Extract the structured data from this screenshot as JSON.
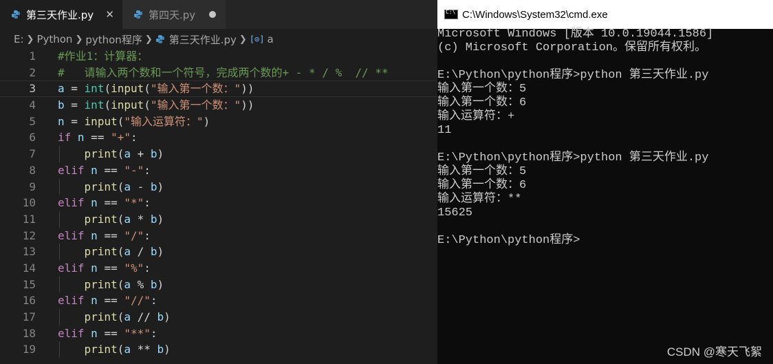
{
  "editor": {
    "tabs": [
      {
        "label": "第三天作业.py",
        "active": true,
        "close_glyph": "✕"
      },
      {
        "label": "第四天.py",
        "active": false
      }
    ],
    "breadcrumb": [
      "E:",
      "Python",
      "python程序",
      "第三天作业.py",
      "a"
    ],
    "current_line": 3,
    "lines": [
      {
        "n": "1",
        "tokens": [
          [
            "cmt",
            "#作业1：计算器："
          ]
        ]
      },
      {
        "n": "2",
        "tokens": [
          [
            "cmt",
            "#   请输入两个数和一个符号，完成两个数的+ - * / %  // **"
          ]
        ]
      },
      {
        "n": "3",
        "tokens": [
          [
            "var",
            "a"
          ],
          [
            "op",
            " = "
          ],
          [
            "bi",
            "int"
          ],
          [
            "op",
            "("
          ],
          [
            "fn",
            "input"
          ],
          [
            "op",
            "("
          ],
          [
            "str",
            "\"输入第一个数：\""
          ],
          [
            "op",
            "))"
          ]
        ]
      },
      {
        "n": "4",
        "tokens": [
          [
            "var",
            "b"
          ],
          [
            "op",
            " = "
          ],
          [
            "bi",
            "int"
          ],
          [
            "op",
            "("
          ],
          [
            "fn",
            "input"
          ],
          [
            "op",
            "("
          ],
          [
            "str",
            "\"输入第一个数：\""
          ],
          [
            "op",
            "))"
          ]
        ]
      },
      {
        "n": "5",
        "tokens": [
          [
            "var",
            "n"
          ],
          [
            "op",
            " = "
          ],
          [
            "fn",
            "input"
          ],
          [
            "op",
            "("
          ],
          [
            "str",
            "\"输入运算符：\""
          ],
          [
            "op",
            ")"
          ]
        ]
      },
      {
        "n": "6",
        "tokens": [
          [
            "kw",
            "if"
          ],
          [
            "op",
            " "
          ],
          [
            "var",
            "n"
          ],
          [
            "op",
            " == "
          ],
          [
            "str",
            "\"+\""
          ],
          [
            "op",
            ":"
          ]
        ]
      },
      {
        "n": "7",
        "indent": true,
        "tokens": [
          [
            "op",
            "    "
          ],
          [
            "fn",
            "print"
          ],
          [
            "op",
            "("
          ],
          [
            "var",
            "a"
          ],
          [
            "op",
            " + "
          ],
          [
            "var",
            "b"
          ],
          [
            "op",
            ")"
          ]
        ]
      },
      {
        "n": "8",
        "tokens": [
          [
            "kw",
            "elif"
          ],
          [
            "op",
            " "
          ],
          [
            "var",
            "n"
          ],
          [
            "op",
            " == "
          ],
          [
            "str",
            "\"-\""
          ],
          [
            "op",
            ":"
          ]
        ]
      },
      {
        "n": "9",
        "indent": true,
        "tokens": [
          [
            "op",
            "    "
          ],
          [
            "fn",
            "print"
          ],
          [
            "op",
            "("
          ],
          [
            "var",
            "a"
          ],
          [
            "op",
            " - "
          ],
          [
            "var",
            "b"
          ],
          [
            "op",
            ")"
          ]
        ]
      },
      {
        "n": "10",
        "tokens": [
          [
            "kw",
            "elif"
          ],
          [
            "op",
            " "
          ],
          [
            "var",
            "n"
          ],
          [
            "op",
            " == "
          ],
          [
            "str",
            "\"*\""
          ],
          [
            "op",
            ":"
          ]
        ]
      },
      {
        "n": "11",
        "indent": true,
        "tokens": [
          [
            "op",
            "    "
          ],
          [
            "fn",
            "print"
          ],
          [
            "op",
            "("
          ],
          [
            "var",
            "a"
          ],
          [
            "op",
            " * "
          ],
          [
            "var",
            "b"
          ],
          [
            "op",
            ")"
          ]
        ]
      },
      {
        "n": "12",
        "tokens": [
          [
            "kw",
            "elif"
          ],
          [
            "op",
            " "
          ],
          [
            "var",
            "n"
          ],
          [
            "op",
            " == "
          ],
          [
            "str",
            "\"/\""
          ],
          [
            "op",
            ":"
          ]
        ]
      },
      {
        "n": "13",
        "indent": true,
        "tokens": [
          [
            "op",
            "    "
          ],
          [
            "fn",
            "print"
          ],
          [
            "op",
            "("
          ],
          [
            "var",
            "a"
          ],
          [
            "op",
            " / "
          ],
          [
            "var",
            "b"
          ],
          [
            "op",
            ")"
          ]
        ]
      },
      {
        "n": "14",
        "tokens": [
          [
            "kw",
            "elif"
          ],
          [
            "op",
            " "
          ],
          [
            "var",
            "n"
          ],
          [
            "op",
            " == "
          ],
          [
            "str",
            "\"%\""
          ],
          [
            "op",
            ":"
          ]
        ]
      },
      {
        "n": "15",
        "indent": true,
        "tokens": [
          [
            "op",
            "    "
          ],
          [
            "fn",
            "print"
          ],
          [
            "op",
            "("
          ],
          [
            "var",
            "a"
          ],
          [
            "op",
            " % "
          ],
          [
            "var",
            "b"
          ],
          [
            "op",
            ")"
          ]
        ]
      },
      {
        "n": "16",
        "tokens": [
          [
            "kw",
            "elif"
          ],
          [
            "op",
            " "
          ],
          [
            "var",
            "n"
          ],
          [
            "op",
            " == "
          ],
          [
            "str",
            "\"//\""
          ],
          [
            "op",
            ":"
          ]
        ]
      },
      {
        "n": "17",
        "indent": true,
        "tokens": [
          [
            "op",
            "    "
          ],
          [
            "fn",
            "print"
          ],
          [
            "op",
            "("
          ],
          [
            "var",
            "a"
          ],
          [
            "op",
            " // "
          ],
          [
            "var",
            "b"
          ],
          [
            "op",
            ")"
          ]
        ]
      },
      {
        "n": "18",
        "tokens": [
          [
            "kw",
            "elif"
          ],
          [
            "op",
            " "
          ],
          [
            "var",
            "n"
          ],
          [
            "op",
            " == "
          ],
          [
            "str",
            "\"**\""
          ],
          [
            "op",
            ":"
          ]
        ]
      },
      {
        "n": "19",
        "indent": true,
        "tokens": [
          [
            "op",
            "    "
          ],
          [
            "fn",
            "print"
          ],
          [
            "op",
            "("
          ],
          [
            "var",
            "a"
          ],
          [
            "op",
            " ** "
          ],
          [
            "var",
            "b"
          ],
          [
            "op",
            ")"
          ]
        ]
      }
    ]
  },
  "cmd": {
    "title": "C:\\Windows\\System32\\cmd.exe",
    "output": [
      "Microsoft Windows [版本 10.0.19044.1586]",
      "(c) Microsoft Corporation。保留所有权利。",
      "",
      "E:\\Python\\python程序>python 第三天作业.py",
      "输入第一个数：5",
      "输入第一个数：6",
      "输入运算符：+",
      "11",
      "",
      "E:\\Python\\python程序>python 第三天作业.py",
      "输入第一个数：5",
      "输入第一个数：6",
      "输入运算符：**",
      "15625",
      "",
      "E:\\Python\\python程序>"
    ]
  },
  "watermark": "CSDN @寒天飞絮",
  "colors": {
    "keyword": "#c586c0",
    "function": "#dcdcaa",
    "builtin": "#4ec9b0",
    "variable": "#9cdcfe",
    "string": "#ce9178",
    "comment": "#6a9955",
    "python_icon": "#4a9ed6"
  }
}
